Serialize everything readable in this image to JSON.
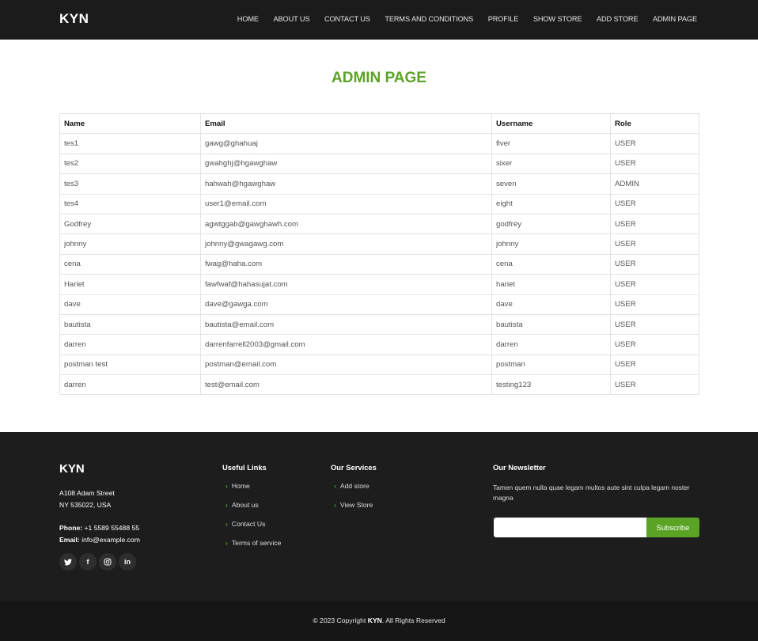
{
  "header": {
    "logo": "KYN",
    "nav": [
      "HOME",
      "ABOUT US",
      "CONTACT US",
      "TERMS AND CONDITIONS",
      "PROFILE",
      "SHOW STORE",
      "ADD STORE",
      "ADMIN PAGE"
    ]
  },
  "main": {
    "title": "ADMIN PAGE",
    "table": {
      "columns": [
        "Name",
        "Email",
        "Username",
        "Role"
      ],
      "rows": [
        [
          "tes1",
          "gawg@ghahuaj",
          "fiver",
          "USER"
        ],
        [
          "tes2",
          "gwahghj@hgawghaw",
          "sixer",
          "USER"
        ],
        [
          "tes3",
          "hahwah@hgawghaw",
          "seven",
          "ADMIN"
        ],
        [
          "tes4",
          "user1@email.com",
          "eight",
          "USER"
        ],
        [
          "Godfrey",
          "agwtggab@gawghawh.com",
          "godfrey",
          "USER"
        ],
        [
          "johnny",
          "johnny@gwagawg.com",
          "johnny",
          "USER"
        ],
        [
          "cena",
          "fwag@haha.com",
          "cena",
          "USER"
        ],
        [
          "Hariet",
          "fawfwaf@hahasujat.com",
          "hariet",
          "USER"
        ],
        [
          "dave",
          "dave@gawga.com",
          "dave",
          "USER"
        ],
        [
          "bautista",
          "bautista@email.com",
          "bautista",
          "USER"
        ],
        [
          "darren",
          "darrenfarrell2003@gmail.com",
          "darren",
          "USER"
        ],
        [
          "postman test",
          "postman@email.com",
          "postman",
          "USER"
        ],
        [
          "darren",
          "test@email.com",
          "testing123",
          "USER"
        ]
      ]
    }
  },
  "footer": {
    "logo": "KYN",
    "address_line1": "A108 Adam Street",
    "address_line2": "NY 535022, USA",
    "phone_label": "Phone:",
    "phone": "+1 5589 55488 55",
    "email_label": "Email:",
    "email": "info@example.com",
    "socials": [
      "twitter-icon",
      "facebook-icon",
      "instagram-icon",
      "linkedin-icon"
    ],
    "useful_links_title": "Useful Links",
    "useful_links": [
      "Home",
      "About us",
      "Contact Us",
      "Terms of service"
    ],
    "services_title": "Our Services",
    "services": [
      "Add store",
      "View Store"
    ],
    "newsletter_title": "Our Newsletter",
    "newsletter_text": "Tamen quem nulla quae legam multos aute sint culpa legam noster magna",
    "subscribe_label": "Subscribe"
  },
  "copyright": {
    "prefix": "© 2023 Copyright",
    "brand": "KYN",
    "suffix": ". All Rights Reserved"
  },
  "colors": {
    "accent": "#5ba325",
    "header_bg": "#1b1b1b",
    "footer_bg": "#1d1d1d"
  }
}
